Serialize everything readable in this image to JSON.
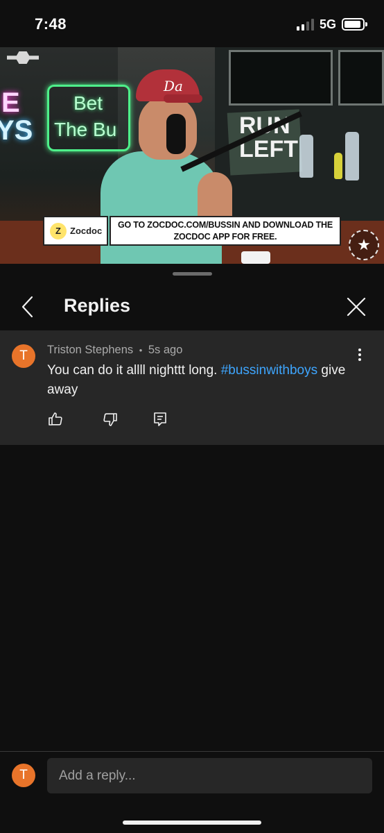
{
  "status_bar": {
    "time": "7:48",
    "network": "5G",
    "signal_bars": 4,
    "signal_bars_filled": 2
  },
  "video": {
    "progress_fraction": 0.39,
    "neon_left_1": "E",
    "neon_left_2": "YS",
    "neon_sign_line1": "Bet",
    "neon_sign_line2": "The Bu",
    "hat_text": "Da",
    "run_sign_line1": "RUN",
    "run_sign_line2": "LEFT",
    "ad": {
      "brand_mark": "Z",
      "brand": "Zocdoc",
      "message": "GO TO ZOCDOC.COM/BUSSIN AND DOWNLOAD THE ZOCDOC APP FOR FREE."
    },
    "channel_logo": "★"
  },
  "panel": {
    "title": "Replies",
    "back_icon": "chevron-left-icon",
    "close_icon": "close-icon"
  },
  "comment": {
    "avatar_letter": "T",
    "author": "Triston Stephens",
    "separator": "•",
    "time_ago": "5s ago",
    "text_before": "You can do it allll nighttt long. ",
    "hashtag": "#bussinwithboys",
    "text_after": " give away",
    "actions": [
      "thumbs-up-icon",
      "thumbs-down-icon",
      "reply-icon"
    ]
  },
  "reply_bar": {
    "avatar_letter": "T",
    "placeholder": "Add a reply..."
  },
  "colors": {
    "background": "#0f0f0f",
    "surface": "#272727",
    "avatar": "#e8742a",
    "link": "#3ea6ff"
  }
}
